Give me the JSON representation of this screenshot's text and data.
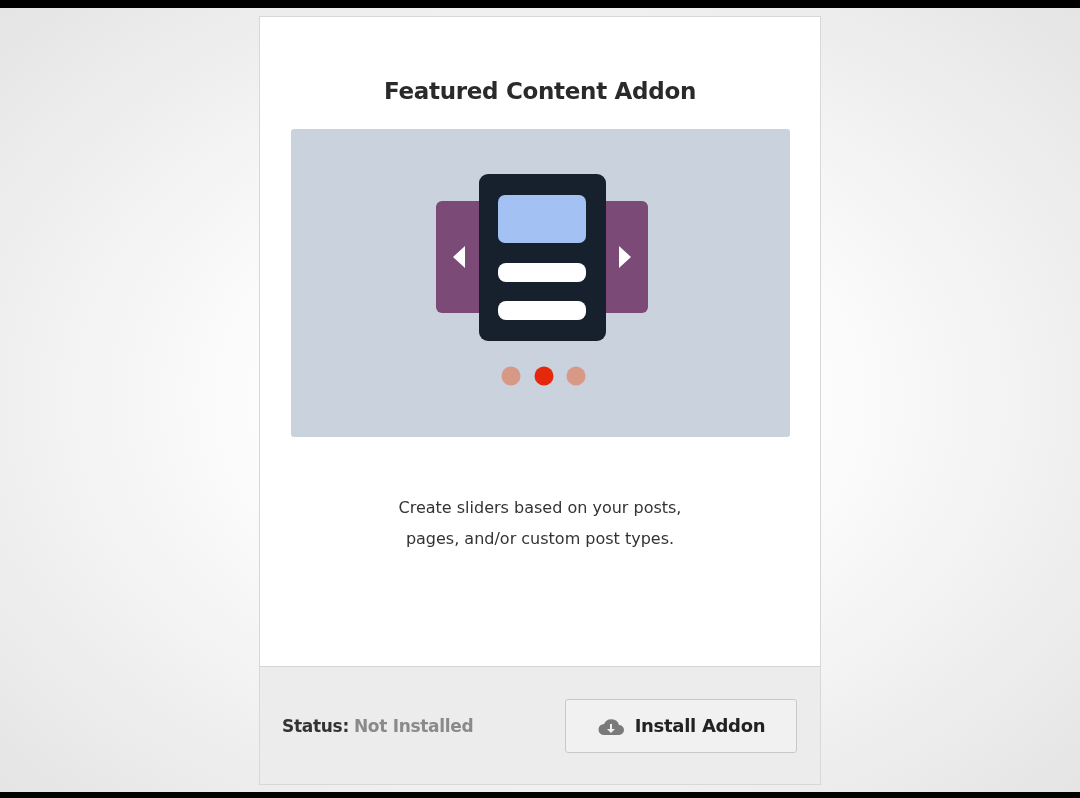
{
  "card": {
    "title": "Featured Content Addon",
    "description": "Create sliders based on your posts, pages, and/or custom post types.",
    "status_label": "Status:",
    "status_value": "Not Installed",
    "button": "Install Addon"
  }
}
